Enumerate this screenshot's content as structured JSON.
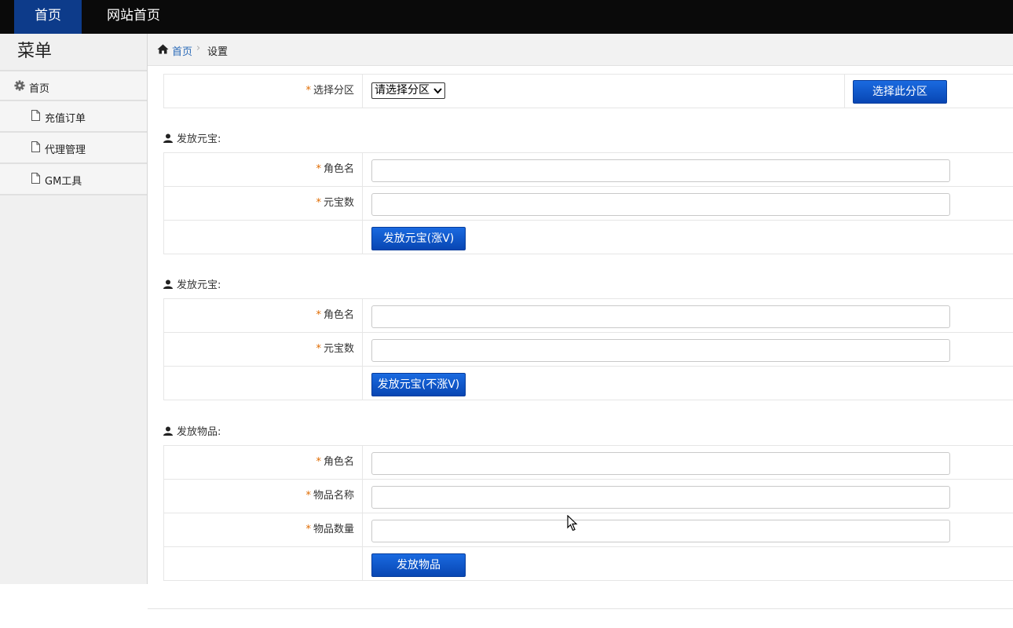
{
  "topbar": {
    "active_item": "首页",
    "site_item": "网站首页"
  },
  "sidebar": {
    "title": "菜单",
    "home": "首页",
    "items": [
      {
        "label": "充值订单"
      },
      {
        "label": "代理管理"
      },
      {
        "label": "GM工具"
      }
    ]
  },
  "breadcrumb": {
    "home": "首页",
    "separator": "›",
    "current": "设置"
  },
  "zone": {
    "label": "选择分区",
    "select_value": "请选择分区",
    "button": "选择此分区"
  },
  "required_mark": "*",
  "section1": {
    "title": "发放元宝:",
    "role_label": "角色名",
    "amount_label": "元宝数",
    "button": "发放元宝(涨V)"
  },
  "section2": {
    "title": "发放元宝:",
    "role_label": "角色名",
    "amount_label": "元宝数",
    "button": "发放元宝(不涨V)"
  },
  "section3": {
    "title": "发放物品:",
    "role_label": "角色名",
    "item_name_label": "物品名称",
    "item_qty_label": "物品数量",
    "button": "发放物品"
  },
  "colors": {
    "accent_button": "#0a52c6",
    "required_star": "#e06b00",
    "topbar_bg": "#0a0a0a",
    "link": "#2a6ab8"
  }
}
